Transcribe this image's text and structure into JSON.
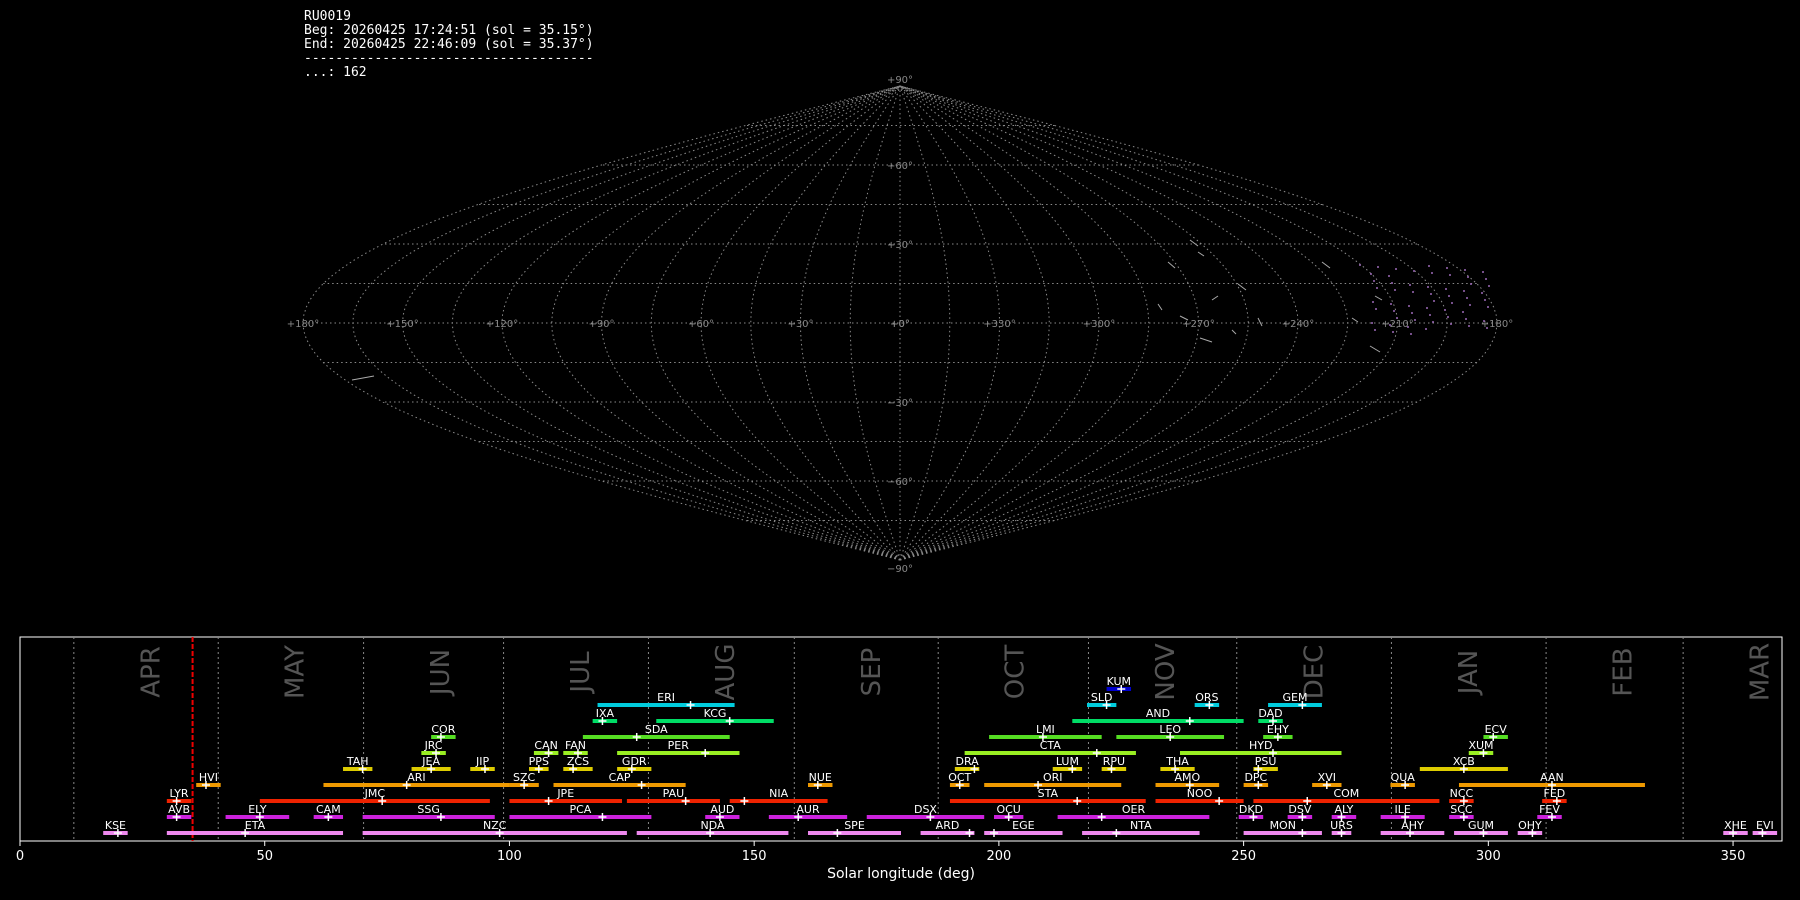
{
  "info": {
    "station": "RU0019",
    "beg": "Beg: 20260425 17:24:51 (sol = 35.15°)",
    "end": "End: 20260425 22:46:09 (sol = 35.37°)",
    "sep": "-------------------------------------",
    "count": "...: 162"
  },
  "chart_data": [
    {
      "type": "map",
      "projection": "sinusoidal",
      "grid": true,
      "lat_labels": [
        "+90°",
        "+60°",
        "+30°",
        "+0°",
        "−30°",
        "−60°",
        "−90°"
      ],
      "lat_values": [
        90,
        60,
        30,
        0,
        -30,
        -60,
        -90
      ],
      "lon_labels": [
        "+180°",
        "+150°",
        "+120°",
        "+90°",
        "+60°",
        "+30°",
        "+0°",
        "+330°",
        "+300°",
        "+270°",
        "+240°",
        "+210°",
        "+180°"
      ]
    },
    {
      "type": "timeline",
      "xlabel": "Solar longitude (deg)",
      "xlim": [
        0,
        360
      ],
      "xticks": [
        0,
        50,
        100,
        150,
        200,
        250,
        300,
        350
      ],
      "current_sol": 35.26,
      "months": [
        {
          "name": "APR",
          "start": 11.0
        },
        {
          "name": "MAY",
          "start": 40.5
        },
        {
          "name": "JUN",
          "start": 70.2
        },
        {
          "name": "JUL",
          "start": 98.8
        },
        {
          "name": "AUG",
          "start": 128.4
        },
        {
          "name": "SEP",
          "start": 158.2
        },
        {
          "name": "OCT",
          "start": 187.6
        },
        {
          "name": "NOV",
          "start": 218.3
        },
        {
          "name": "DEC",
          "start": 248.6
        },
        {
          "name": "JAN",
          "start": 280.2
        },
        {
          "name": "FEB",
          "start": 311.8
        },
        {
          "name": "MAR",
          "start": 339.8
        }
      ],
      "showers": [
        {
          "code": "KUM",
          "start": 222,
          "end": 227,
          "peak": 225,
          "row": 9,
          "color": "#0000cc"
        },
        {
          "code": "ERI",
          "start": 118,
          "end": 146,
          "peak": 137,
          "row": 8,
          "color": "#00ccdd"
        },
        {
          "code": "SLD",
          "start": 218,
          "end": 224,
          "peak": 222,
          "row": 8,
          "color": "#00ccdd"
        },
        {
          "code": "ORS",
          "start": 240,
          "end": 245,
          "peak": 243,
          "row": 8,
          "color": "#00ccdd"
        },
        {
          "code": "GEM",
          "start": 255,
          "end": 266,
          "peak": 262,
          "row": 8,
          "color": "#00ccdd"
        },
        {
          "code": "IXA",
          "start": 117,
          "end": 122,
          "peak": 119,
          "row": 7,
          "color": "#00dd66"
        },
        {
          "code": "KCG",
          "start": 130,
          "end": 154,
          "peak": 145,
          "row": 7,
          "color": "#00dd66"
        },
        {
          "code": "AND",
          "start": 215,
          "end": 250,
          "peak": 239,
          "row": 7,
          "color": "#00dd66"
        },
        {
          "code": "DAD",
          "start": 253,
          "end": 258,
          "peak": 256,
          "row": 7,
          "color": "#00dd66"
        },
        {
          "code": "COR",
          "start": 84,
          "end": 89,
          "peak": 86,
          "row": 6,
          "color": "#55dd22"
        },
        {
          "code": "SDA",
          "start": 115,
          "end": 145,
          "peak": 126,
          "row": 6,
          "color": "#55dd22"
        },
        {
          "code": "LMI",
          "start": 198,
          "end": 221,
          "peak": 209,
          "row": 6,
          "color": "#55dd22"
        },
        {
          "code": "LEO",
          "start": 224,
          "end": 246,
          "peak": 235,
          "row": 6,
          "color": "#55dd22"
        },
        {
          "code": "EHY",
          "start": 254,
          "end": 260,
          "peak": 257,
          "row": 6,
          "color": "#55dd22"
        },
        {
          "code": "ECV",
          "start": 299,
          "end": 304,
          "peak": 301,
          "row": 6,
          "color": "#55dd22"
        },
        {
          "code": "JRC",
          "start": 82,
          "end": 87,
          "peak": 85,
          "row": 5,
          "color": "#99ee22"
        },
        {
          "code": "CAN",
          "start": 105,
          "end": 110,
          "peak": 108,
          "row": 5,
          "color": "#99ee22"
        },
        {
          "code": "FAN",
          "start": 111,
          "end": 116,
          "peak": 114,
          "row": 5,
          "color": "#99ee22"
        },
        {
          "code": "PER",
          "start": 122,
          "end": 147,
          "peak": 140,
          "row": 5,
          "color": "#99ee22"
        },
        {
          "code": "CTA",
          "start": 193,
          "end": 228,
          "peak": 220,
          "row": 5,
          "color": "#99ee22"
        },
        {
          "code": "HYD",
          "start": 237,
          "end": 270,
          "peak": 256,
          "row": 5,
          "color": "#99ee22"
        },
        {
          "code": "XUM",
          "start": 296,
          "end": 301,
          "peak": 299,
          "row": 5,
          "color": "#99ee22"
        },
        {
          "code": "TAH",
          "start": 66,
          "end": 72,
          "peak": 70,
          "row": 4,
          "color": "#ddcc00"
        },
        {
          "code": "JEA",
          "start": 80,
          "end": 88,
          "peak": 84,
          "row": 4,
          "color": "#ddcc00"
        },
        {
          "code": "JIP",
          "start": 92,
          "end": 97,
          "peak": 95,
          "row": 4,
          "color": "#ddcc00"
        },
        {
          "code": "PPS",
          "start": 104,
          "end": 108,
          "peak": 106,
          "row": 4,
          "color": "#ddcc00"
        },
        {
          "code": "ZCS",
          "start": 111,
          "end": 117,
          "peak": 113,
          "row": 4,
          "color": "#ddcc00"
        },
        {
          "code": "GDR",
          "start": 122,
          "end": 129,
          "peak": 125,
          "row": 4,
          "color": "#ddcc00"
        },
        {
          "code": "DRA",
          "start": 191,
          "end": 196,
          "peak": 195,
          "row": 4,
          "color": "#ddcc00"
        },
        {
          "code": "LUM",
          "start": 211,
          "end": 217,
          "peak": 215,
          "row": 4,
          "color": "#ddcc00"
        },
        {
          "code": "RPU",
          "start": 221,
          "end": 226,
          "peak": 223,
          "row": 4,
          "color": "#ddcc00"
        },
        {
          "code": "THA",
          "start": 233,
          "end": 240,
          "peak": 236,
          "row": 4,
          "color": "#ddcc00"
        },
        {
          "code": "PSU",
          "start": 252,
          "end": 257,
          "peak": 253,
          "row": 4,
          "color": "#ddcc00"
        },
        {
          "code": "XCB",
          "start": 286,
          "end": 304,
          "peak": 295,
          "row": 4,
          "color": "#ddcc00"
        },
        {
          "code": "HVI",
          "start": 36,
          "end": 41,
          "peak": 38,
          "row": 3,
          "color": "#ee9900"
        },
        {
          "code": "ARI",
          "start": 62,
          "end": 100,
          "peak": 79,
          "row": 3,
          "color": "#ee9900"
        },
        {
          "code": "SZC",
          "start": 100,
          "end": 106,
          "peak": 103,
          "row": 3,
          "color": "#ee9900"
        },
        {
          "code": "CAP",
          "start": 109,
          "end": 136,
          "peak": 127,
          "row": 3,
          "color": "#ee9900"
        },
        {
          "code": "NUE",
          "start": 161,
          "end": 166,
          "peak": 163,
          "row": 3,
          "color": "#ee9900"
        },
        {
          "code": "OCT",
          "start": 190,
          "end": 194,
          "peak": 192,
          "row": 3,
          "color": "#ee9900"
        },
        {
          "code": "ORI",
          "start": 197,
          "end": 225,
          "peak": 208,
          "row": 3,
          "color": "#ee9900"
        },
        {
          "code": "AMO",
          "start": 232,
          "end": 245,
          "peak": 239,
          "row": 3,
          "color": "#ee9900"
        },
        {
          "code": "DPC",
          "start": 250,
          "end": 255,
          "peak": 253,
          "row": 3,
          "color": "#ee9900"
        },
        {
          "code": "XVI",
          "start": 264,
          "end": 270,
          "peak": 267,
          "row": 3,
          "color": "#ee9900"
        },
        {
          "code": "QUA",
          "start": 280,
          "end": 285,
          "peak": 283,
          "row": 3,
          "color": "#ee9900"
        },
        {
          "code": "AAN",
          "start": 294,
          "end": 332,
          "peak": 313,
          "row": 3,
          "color": "#ee9900"
        },
        {
          "code": "LYR",
          "start": 30,
          "end": 35,
          "peak": 32,
          "row": 2,
          "color": "#ee2200"
        },
        {
          "code": "JMC",
          "start": 49,
          "end": 96,
          "peak": 74,
          "row": 2,
          "color": "#ee2200"
        },
        {
          "code": "JPE",
          "start": 100,
          "end": 123,
          "peak": 108,
          "row": 2,
          "color": "#ee2200"
        },
        {
          "code": "PAU",
          "start": 124,
          "end": 143,
          "peak": 136,
          "row": 2,
          "color": "#ee2200"
        },
        {
          "code": "NIA",
          "start": 145,
          "end": 165,
          "peak": 148,
          "row": 2,
          "color": "#ee2200"
        },
        {
          "code": "STA",
          "start": 190,
          "end": 230,
          "peak": 216,
          "row": 2,
          "color": "#ee2200"
        },
        {
          "code": "NOO",
          "start": 232,
          "end": 250,
          "peak": 245,
          "row": 2,
          "color": "#ee2200"
        },
        {
          "code": "COM",
          "start": 252,
          "end": 290,
          "peak": 263,
          "row": 2,
          "color": "#ee2200"
        },
        {
          "code": "NCC",
          "start": 292,
          "end": 297,
          "peak": 295,
          "row": 2,
          "color": "#ee2200"
        },
        {
          "code": "FED",
          "start": 311,
          "end": 316,
          "peak": 314,
          "row": 2,
          "color": "#ee2200"
        },
        {
          "code": "AVB",
          "start": 30,
          "end": 35,
          "peak": 32,
          "row": 1,
          "color": "#cc22dd"
        },
        {
          "code": "ELY",
          "start": 42,
          "end": 55,
          "peak": 49,
          "row": 1,
          "color": "#cc22dd"
        },
        {
          "code": "CAM",
          "start": 60,
          "end": 66,
          "peak": 63,
          "row": 1,
          "color": "#cc22dd"
        },
        {
          "code": "SSG",
          "start": 70,
          "end": 97,
          "peak": 86,
          "row": 1,
          "color": "#cc22dd"
        },
        {
          "code": "PCA",
          "start": 100,
          "end": 129,
          "peak": 119,
          "row": 1,
          "color": "#cc22dd"
        },
        {
          "code": "AUD",
          "start": 140,
          "end": 147,
          "peak": 143,
          "row": 1,
          "color": "#cc22dd"
        },
        {
          "code": "AUR",
          "start": 153,
          "end": 169,
          "peak": 159,
          "row": 1,
          "color": "#cc22dd"
        },
        {
          "code": "DSX",
          "start": 173,
          "end": 197,
          "peak": 186,
          "row": 1,
          "color": "#cc22dd"
        },
        {
          "code": "OCU",
          "start": 199,
          "end": 205,
          "peak": 202,
          "row": 1,
          "color": "#cc22dd"
        },
        {
          "code": "OER",
          "start": 212,
          "end": 243,
          "peak": 221,
          "row": 1,
          "color": "#cc22dd"
        },
        {
          "code": "DKD",
          "start": 249,
          "end": 254,
          "peak": 252,
          "row": 1,
          "color": "#cc22dd"
        },
        {
          "code": "DSV",
          "start": 259,
          "end": 264,
          "peak": 262,
          "row": 1,
          "color": "#cc22dd"
        },
        {
          "code": "ALY",
          "start": 268,
          "end": 273,
          "peak": 270,
          "row": 1,
          "color": "#cc22dd"
        },
        {
          "code": "ILE",
          "start": 278,
          "end": 287,
          "peak": 283,
          "row": 1,
          "color": "#cc22dd"
        },
        {
          "code": "SCC",
          "start": 292,
          "end": 297,
          "peak": 295,
          "row": 1,
          "color": "#cc22dd"
        },
        {
          "code": "FEV",
          "start": 310,
          "end": 315,
          "peak": 313,
          "row": 1,
          "color": "#cc22dd"
        },
        {
          "code": "KSE",
          "start": 17,
          "end": 22,
          "peak": 20,
          "row": 0,
          "color": "#ee88ee"
        },
        {
          "code": "ETA",
          "start": 30,
          "end": 66,
          "peak": 46,
          "row": 0,
          "color": "#ee88ee"
        },
        {
          "code": "NZC",
          "start": 70,
          "end": 124,
          "peak": 98,
          "row": 0,
          "color": "#ee88ee"
        },
        {
          "code": "NDA",
          "start": 126,
          "end": 157,
          "peak": 141,
          "row": 0,
          "color": "#ee88ee"
        },
        {
          "code": "SPE",
          "start": 161,
          "end": 180,
          "peak": 167,
          "row": 0,
          "color": "#ee88ee"
        },
        {
          "code": "ARD",
          "start": 184,
          "end": 195,
          "peak": 194,
          "row": 0,
          "color": "#ee88ee"
        },
        {
          "code": "EGE",
          "start": 197,
          "end": 213,
          "peak": 199,
          "row": 0,
          "color": "#ee88ee"
        },
        {
          "code": "NTA",
          "start": 217,
          "end": 241,
          "peak": 224,
          "row": 0,
          "color": "#ee88ee"
        },
        {
          "code": "MON",
          "start": 250,
          "end": 266,
          "peak": 262,
          "row": 0,
          "color": "#ee88ee"
        },
        {
          "code": "URS",
          "start": 268,
          "end": 272,
          "peak": 270,
          "row": 0,
          "color": "#ee88ee"
        },
        {
          "code": "AHY",
          "start": 278,
          "end": 291,
          "peak": 284,
          "row": 0,
          "color": "#ee88ee"
        },
        {
          "code": "GUM",
          "start": 293,
          "end": 304,
          "peak": 299,
          "row": 0,
          "color": "#ee88ee"
        },
        {
          "code": "OHY",
          "start": 306,
          "end": 311,
          "peak": 309,
          "row": 0,
          "color": "#ee88ee"
        },
        {
          "code": "XHE",
          "start": 348,
          "end": 353,
          "peak": 350,
          "row": 0,
          "color": "#ee88ee"
        },
        {
          "code": "EVI",
          "start": 354,
          "end": 359,
          "peak": 356,
          "row": 0,
          "color": "#ee88ee"
        }
      ]
    }
  ]
}
